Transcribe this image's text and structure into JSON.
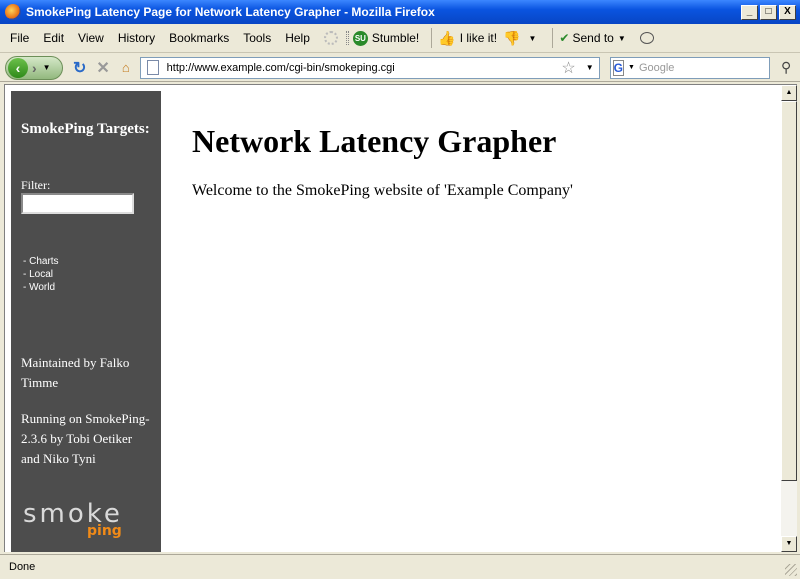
{
  "window": {
    "title": "SmokePing Latency Page for Network Latency Grapher - Mozilla Firefox",
    "minimize": "_",
    "maximize": "□",
    "close": "X"
  },
  "menu": {
    "items": [
      "File",
      "Edit",
      "View",
      "History",
      "Bookmarks",
      "Tools",
      "Help"
    ],
    "stumble": "Stumble!",
    "stumble_icon_text": "SU",
    "ilike": "I like it!",
    "sendto": "Send to"
  },
  "nav": {
    "url": "http://www.example.com/cgi-bin/smokeping.cgi",
    "search_placeholder": "Google",
    "search_engine_letter": "G"
  },
  "sidebar": {
    "title": "SmokePing Targets:",
    "filter_label": "Filter:",
    "targets": [
      "- Charts",
      "- Local",
      "- World"
    ],
    "maintained": "Maintained by Falko Timme",
    "running": "Running on SmokePing-2.3.6 by Tobi Oetiker and Niko Tyni",
    "logo_smoke": "smoke",
    "logo_ping": "ping"
  },
  "main": {
    "heading": "Network Latency Grapher",
    "welcome": "Welcome to the SmokePing website of 'Example Company'"
  },
  "status": {
    "text": "Done"
  },
  "colors": {
    "sidebar_bg": "#4d4d4d",
    "titlebar_blue": "#0a54e0",
    "logo_orange": "#f08a18"
  }
}
